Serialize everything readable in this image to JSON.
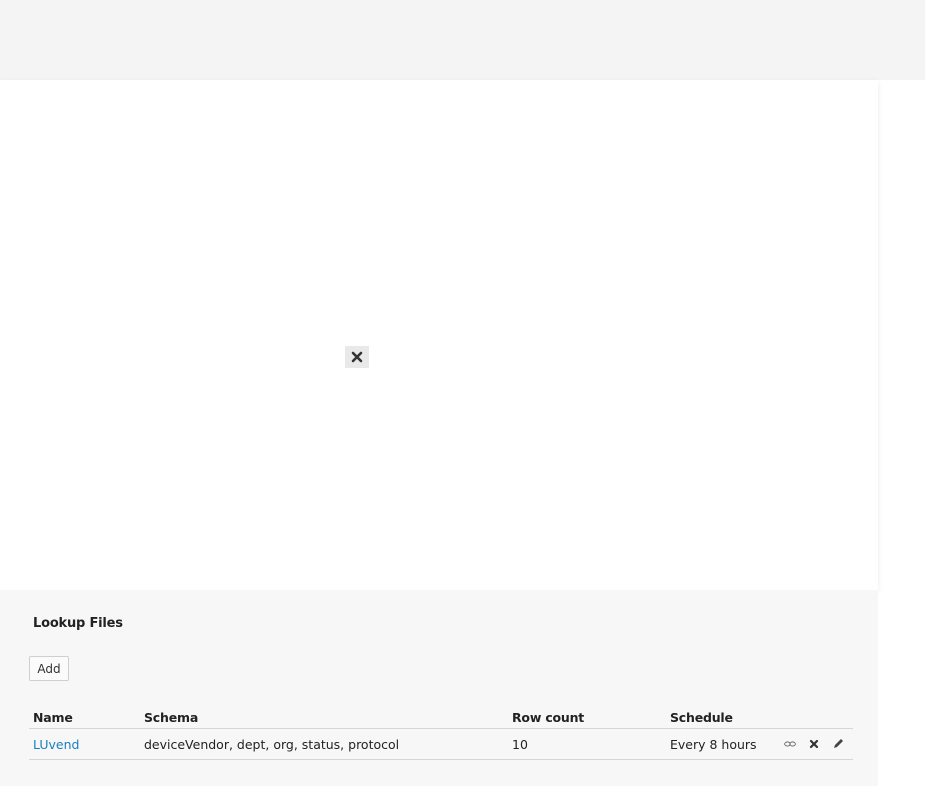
{
  "panel": {
    "title": "Lookup Files",
    "add_label": "Add"
  },
  "table": {
    "headers": {
      "name": "Name",
      "schema": "Schema",
      "row_count": "Row count",
      "schedule": "Schedule"
    },
    "rows": [
      {
        "name": "LUvend",
        "schema": "deviceVendor, dept, org, status, protocol",
        "row_count": "10",
        "schedule": "Every 8 hours"
      }
    ]
  },
  "icons": {
    "modal_close": "close-icon",
    "row_actions": [
      "link-icon",
      "delete-icon",
      "edit-icon"
    ]
  },
  "colors": {
    "link": "#1a7fc1",
    "top_bar": "#f4f4f4",
    "panel_bg": "#f7f7f7"
  }
}
